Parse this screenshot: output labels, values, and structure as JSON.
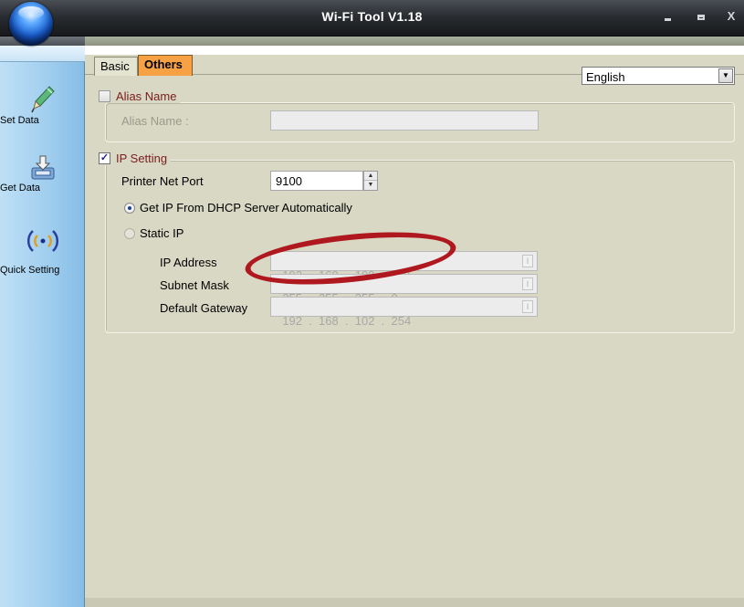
{
  "window": {
    "title": "Wi-Fi Tool V1.18",
    "minimize": "_",
    "maximize": "□",
    "close": "X"
  },
  "sidebar": {
    "items": [
      {
        "label": "Set Data",
        "icon": "pen-icon"
      },
      {
        "label": "Get Data",
        "icon": "download-tray-icon"
      },
      {
        "label": "Quick Setting",
        "icon": "wireless-icon"
      }
    ]
  },
  "tabs": [
    {
      "label": "Basic",
      "active": false
    },
    {
      "label": "Others",
      "active": true
    }
  ],
  "language": {
    "selected": "English"
  },
  "alias_group": {
    "title": "Alias Name",
    "checked": false,
    "field_label": "Alias Name :",
    "field_value": ""
  },
  "ip_group": {
    "title": "IP Setting",
    "checked": true,
    "net_port_label": "Printer Net Port",
    "net_port_value": "9100",
    "dhcp_label": "Get IP From DHCP Server Automatically",
    "dhcp_selected": true,
    "static_label": "Static IP",
    "static_selected": false,
    "ip_address_label": "IP Address",
    "ip_address_value": "192  .  168  .  102  .  118",
    "subnet_label": "Subnet Mask",
    "subnet_value": "255  .  255  .  255  .  0",
    "gateway_label": "Default Gateway",
    "gateway_value": "192  .  168  .  102  .  254"
  },
  "colors": {
    "active_tab": "#f6a144",
    "group_title": "#7a1d1d",
    "annotation": "#b0181f",
    "panel_bg": "#d8d8c4"
  }
}
